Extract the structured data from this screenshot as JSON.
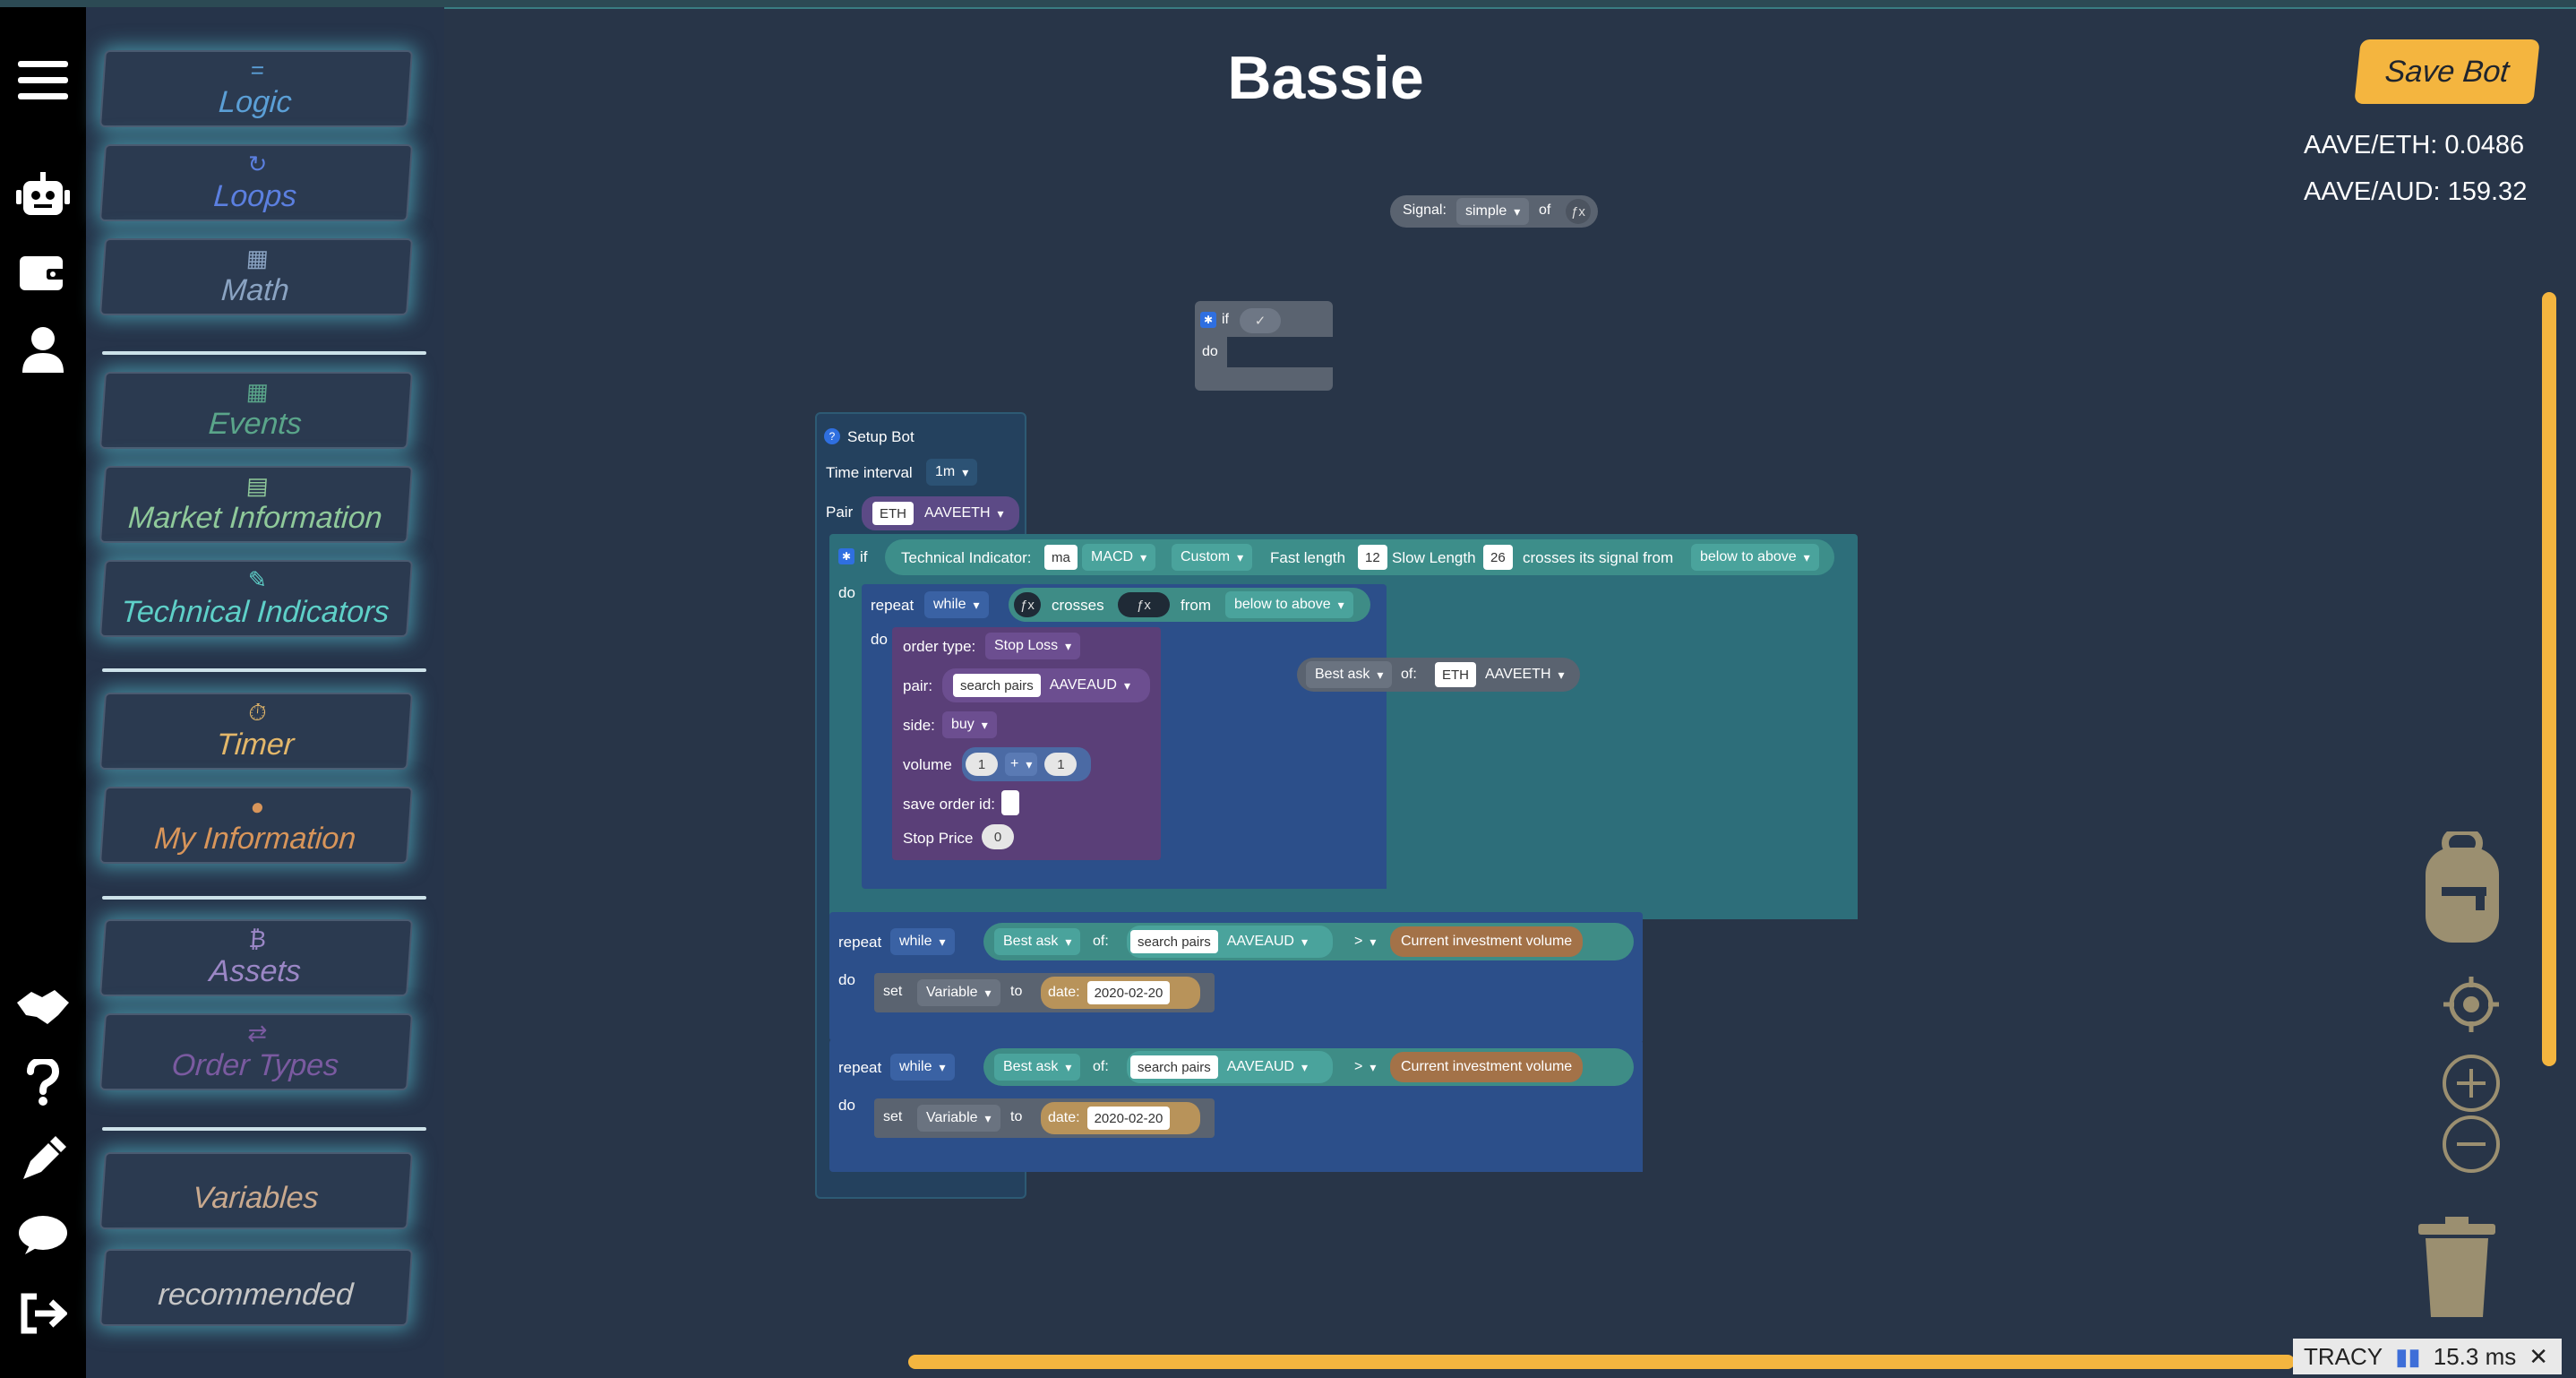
{
  "rail": {
    "icons": [
      "menu-icon",
      "robot-icon",
      "wallet-icon",
      "user-icon",
      "handshake-icon",
      "help-icon",
      "pen-icon",
      "chat-icon",
      "logout-icon"
    ]
  },
  "toolbox": {
    "categories": [
      {
        "label": "Logic",
        "icon": "=",
        "color": "#5b9fd6"
      },
      {
        "label": "Loops",
        "icon": "↻",
        "color": "#5b7fe0"
      },
      {
        "label": "Math",
        "icon": "▦",
        "color": "#8aa3c2"
      },
      {
        "label": "Events",
        "icon": "▦",
        "color": "#5aa58a"
      },
      {
        "label": "Market Information",
        "icon": "▤",
        "color": "#8fc99a"
      },
      {
        "label": "Technical Indicators",
        "icon": "✎",
        "color": "#5ed0c8"
      },
      {
        "label": "Timer",
        "icon": "⏱",
        "color": "#e3b76a"
      },
      {
        "label": "My Information",
        "icon": "●",
        "color": "#d8955a"
      },
      {
        "label": "Assets",
        "icon": "₿",
        "color": "#9b87c6"
      },
      {
        "label": "Order Types",
        "icon": "⇄",
        "color": "#7a5aa0"
      },
      {
        "label": "Variables",
        "icon": "",
        "color": "#c9a98e"
      },
      {
        "label": "recommended",
        "icon": "",
        "color": "#c6c6c6"
      }
    ]
  },
  "header": {
    "title": "Bassie",
    "save_label": "Save Bot",
    "prices": [
      "AAVE/ETH: 0.0486",
      "AAVE/AUD: 159.32"
    ]
  },
  "blocks": {
    "signal": {
      "label": "Signal:",
      "mode": "simple",
      "of": "of",
      "fx": "ƒx"
    },
    "if_small": {
      "if": "if",
      "check": "✓",
      "do": "do"
    },
    "setup": {
      "title": "Setup Bot",
      "time_interval_label": "Time interval",
      "time_interval": "1m",
      "pair_label": "Pair",
      "pair_base": "ETH",
      "pair_value": "AAVEETH"
    },
    "if_main": {
      "if": "if",
      "do": "do",
      "indicator_label": "Technical Indicator:",
      "indicator_field": "ma",
      "indicator": "MACD",
      "mode": "Custom",
      "fast_label": "Fast length",
      "fast": "12",
      "slow_label": "Slow Length",
      "slow": "26",
      "cross_text": "crosses its signal from",
      "direction": "below to above"
    },
    "repeat1": {
      "repeat": "repeat",
      "while": "while",
      "do": "do",
      "fx": "ƒx",
      "crosses": "crosses",
      "fx2": "ƒx",
      "from": "from",
      "direction": "below to above"
    },
    "order": {
      "order_type_label": "order type:",
      "order_type": "Stop Loss",
      "pair_label": "pair:",
      "pair_search": "search pairs",
      "pair": "AAVEAUD",
      "side_label": "side:",
      "side": "buy",
      "volume_label": "volume",
      "vol_a": "1",
      "vol_op": "+",
      "vol_b": "1",
      "save_label": "save order id:",
      "stop_label": "Stop Price",
      "stop": "0"
    },
    "best_ask_free": {
      "label": "Best ask",
      "of": "of:",
      "base": "ETH",
      "pair": "AAVEETH"
    },
    "repeat2": {
      "repeat": "repeat",
      "while": "while",
      "do": "do",
      "best": "Best ask",
      "of": "of:",
      "search": "search pairs",
      "pair": "AAVEAUD",
      "op": ">",
      "rhs": "Current investment volume",
      "set": "set",
      "var": "Variable",
      "to": "to",
      "date_label": "date:",
      "date": "2020-02-20"
    },
    "repeat3": {
      "repeat": "repeat",
      "while": "while",
      "do": "do",
      "best": "Best ask",
      "of": "of:",
      "search": "search pairs",
      "pair": "AAVEAUD",
      "op": ">",
      "rhs": "Current investment volume",
      "set": "set",
      "var": "Variable",
      "to": "to",
      "date_label": "date:",
      "date": "2020-02-20"
    }
  },
  "tracy": {
    "label": "TRACY",
    "time": "15.3 ms",
    "close": "✕"
  },
  "colors": {
    "accent": "#f4b53f",
    "toolbox_glow": "#5ed6e6",
    "workspace": "#283548"
  }
}
